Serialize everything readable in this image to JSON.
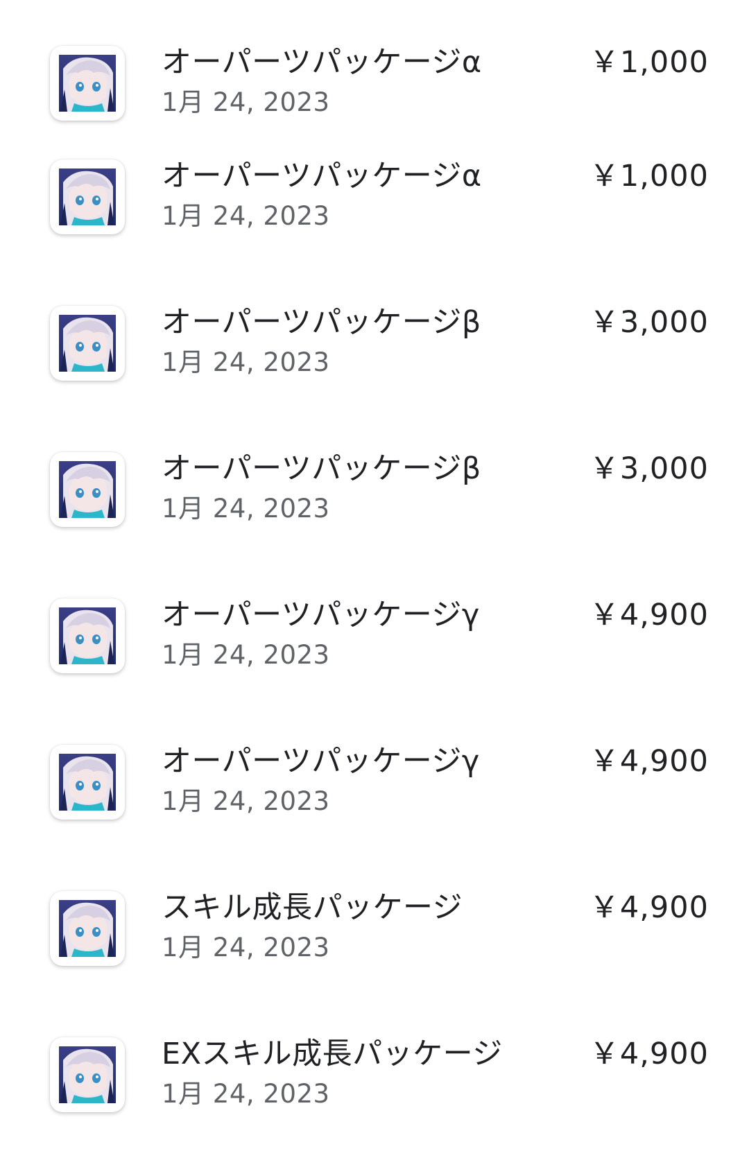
{
  "purchases": [
    {
      "icon": "app-icon",
      "title": "オーパーツパッケージα",
      "date": "1月 24, 2023",
      "price": "￥1,000"
    },
    {
      "icon": "app-icon",
      "title": "オーパーツパッケージα",
      "date": "1月 24, 2023",
      "price": "￥1,000"
    },
    {
      "icon": "app-icon",
      "title": "オーパーツパッケージβ",
      "date": "1月 24, 2023",
      "price": "￥3,000"
    },
    {
      "icon": "app-icon",
      "title": "オーパーツパッケージβ",
      "date": "1月 24, 2023",
      "price": "￥3,000"
    },
    {
      "icon": "app-icon",
      "title": "オーパーツパッケージγ",
      "date": "1月 24, 2023",
      "price": "￥4,900"
    },
    {
      "icon": "app-icon",
      "title": "オーパーツパッケージγ",
      "date": "1月 24, 2023",
      "price": "￥4,900"
    },
    {
      "icon": "app-icon",
      "title": "スキル成長パッケージ",
      "date": "1月 24, 2023",
      "price": "￥4,900"
    },
    {
      "icon": "app-icon",
      "title": "EXスキル成長パッケージ",
      "date": "1月 24, 2023",
      "price": "￥4,900"
    }
  ]
}
